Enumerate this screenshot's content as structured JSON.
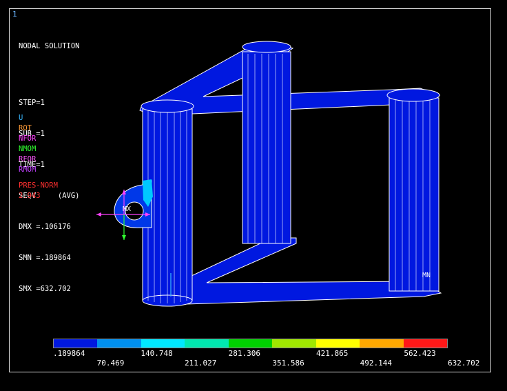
{
  "window_number": "1",
  "info": {
    "title": "NODAL SOLUTION",
    "step": "STEP=1",
    "sub": "SUB =1",
    "time": "TIME=1",
    "result": "SEQV     (AVG)",
    "dmx": "DMX =.106176",
    "smn": "SMN =.189864",
    "smx": "SMX =632.702"
  },
  "symbols": {
    "u": "U",
    "rot": "ROT",
    "nfor": "NFOR",
    "nmom": "NMOM",
    "rfor": "RFOR",
    "rmom": "RMOM",
    "pres_label": "PRES-NORM",
    "pres_value": "2.943"
  },
  "symbol_colors": {
    "u": "#38b8ff",
    "rot": "#ff9c38",
    "nfor": "#ff40ff",
    "nmom": "#30ff30",
    "rfor": "#ff58ff",
    "rmom": "#c040ff",
    "pres": "#ff3030"
  },
  "markers": {
    "mx": "MX",
    "mn": "MN"
  },
  "colorbar": {
    "colors": [
      "#0018e0",
      "#0090f0",
      "#00e8ff",
      "#00e8b0",
      "#00d000",
      "#a0e800",
      "#ffff00",
      "#ffa800",
      "#ff1818"
    ],
    "labels_top": [
      ".189864",
      "140.748",
      "281.306",
      "421.865",
      "562.423"
    ],
    "labels_bottom": [
      "70.469",
      "211.027",
      "351.586",
      "492.144",
      "632.702"
    ]
  }
}
